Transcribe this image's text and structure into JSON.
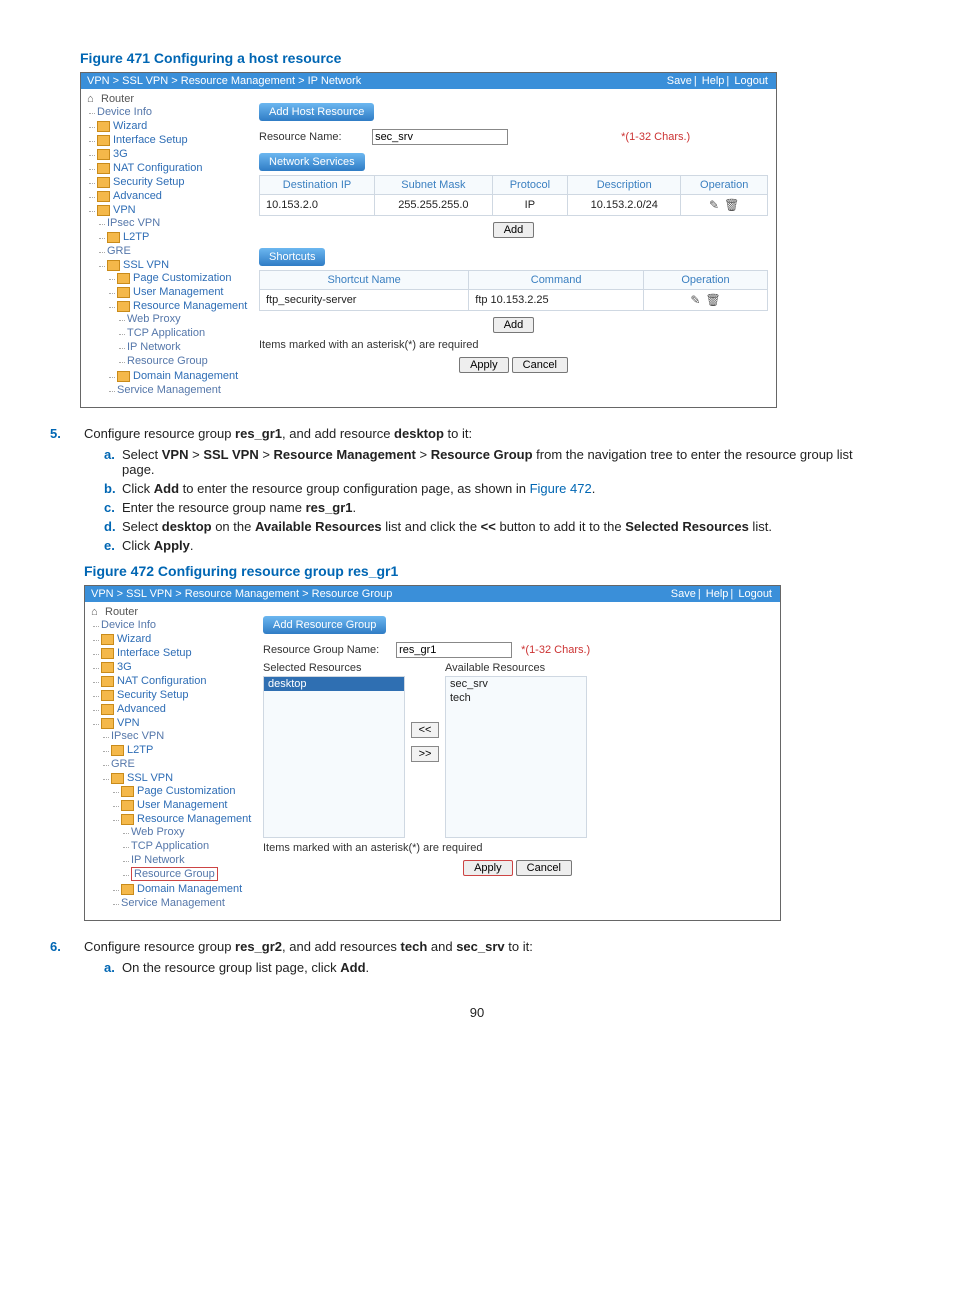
{
  "page_number": "90",
  "figure471": {
    "caption": "Figure 471 Configuring a host resource",
    "breadcrumb": "VPN > SSL VPN > Resource Management > IP Network",
    "toolbar": {
      "save": "Save",
      "help": "Help",
      "logout": "Logout"
    },
    "nav_root": "Router",
    "nav": {
      "device_info": "Device Info",
      "wizard": "Wizard",
      "interface_setup": "Interface Setup",
      "g3": "3G",
      "nat": "NAT Configuration",
      "security": "Security Setup",
      "advanced": "Advanced",
      "vpn": "VPN",
      "ipsec": "IPsec VPN",
      "l2tp": "L2TP",
      "gre": "GRE",
      "sslvpn": "SSL VPN",
      "page_cust": "Page Customization",
      "user_mgmt": "User Management",
      "res_mgmt": "Resource Management",
      "web_proxy": "Web Proxy",
      "tcp_app": "TCP Application",
      "ip_net": "IP Network",
      "res_group": "Resource Group",
      "domain_mgmt": "Domain Management",
      "service_mgmt": "Service Management"
    },
    "section_add_host": "Add Host Resource",
    "resource_name_label": "Resource Name:",
    "resource_name_value": "sec_srv",
    "chars_hint": "*(1-32 Chars.)",
    "section_net_services": "Network Services",
    "ns_headers": {
      "dest_ip": "Destination IP",
      "mask": "Subnet Mask",
      "protocol": "Protocol",
      "desc": "Description",
      "op": "Operation"
    },
    "ns_row": {
      "dest_ip": "10.153.2.0",
      "mask": "255.255.255.0",
      "protocol": "IP",
      "desc": "10.153.2.0/24"
    },
    "add_btn": "Add",
    "section_shortcuts": "Shortcuts",
    "sc_headers": {
      "name": "Shortcut Name",
      "cmd": "Command",
      "op": "Operation"
    },
    "sc_row": {
      "name": "ftp_security-server",
      "cmd": "ftp 10.153.2.25"
    },
    "required_note": "Items marked with an asterisk(*) are required",
    "apply_btn": "Apply",
    "cancel_btn": "Cancel"
  },
  "figure472": {
    "caption": "Figure 472 Configuring resource group res_gr1",
    "breadcrumb": "VPN > SSL VPN > Resource Management > Resource Group",
    "toolbar": {
      "save": "Save",
      "help": "Help",
      "logout": "Logout"
    },
    "section_add_group": "Add Resource Group",
    "group_name_label": "Resource Group Name:",
    "group_name_value": "res_gr1",
    "chars_hint": "*(1-32 Chars.)",
    "selected_label": "Selected Resources",
    "available_label": "Available Resources",
    "selected_items": {
      "0": "desktop"
    },
    "available_items": {
      "0": "sec_srv",
      "1": "tech"
    },
    "move_left": "<<",
    "move_right": ">>",
    "required_note": "Items marked with an asterisk(*) are required",
    "apply_btn": "Apply",
    "cancel_btn": "Cancel"
  },
  "step5": {
    "intro_prefix": "Configure resource group ",
    "res_gr1": "res_gr1",
    "intro_mid": ", and add resource ",
    "desktop": "desktop",
    "intro_suffix": " to it:",
    "a_prefix": "Select ",
    "a_vpn": "VPN",
    "a_gt1": " > ",
    "a_sslvpn": "SSL VPN",
    "a_gt2": " > ",
    "a_resmgmt": "Resource Management",
    "a_gt3": " > ",
    "a_resgrp": "Resource Group",
    "a_suffix": " from the navigation tree to enter the resource group list page.",
    "b_prefix": "Click ",
    "b_add": "Add",
    "b_mid": " to enter the resource group configuration page, as shown in ",
    "b_figref": "Figure 472",
    "b_suffix": ".",
    "c_prefix": "Enter the resource group name ",
    "c_val": "res_gr1",
    "c_suffix": ".",
    "d_prefix": "Select ",
    "d_desktop": "desktop",
    "d_mid1": " on the ",
    "d_avail": "Available Resources",
    "d_mid2": " list and click the ",
    "d_btn": "<<",
    "d_mid3": " button to add it to the ",
    "d_sel": "Selected Resources",
    "d_suffix": " list.",
    "e_prefix": "Click ",
    "e_apply": "Apply",
    "e_suffix": "."
  },
  "step6": {
    "intro_prefix": "Configure resource group ",
    "res_gr2": "res_gr2",
    "intro_mid1": ", and add resources ",
    "tech": "tech",
    "intro_mid2": " and ",
    "sec_srv": "sec_srv",
    "intro_suffix": " to it:",
    "a_text_prefix": "On the resource group list page, click ",
    "a_add": "Add",
    "a_suffix": "."
  }
}
